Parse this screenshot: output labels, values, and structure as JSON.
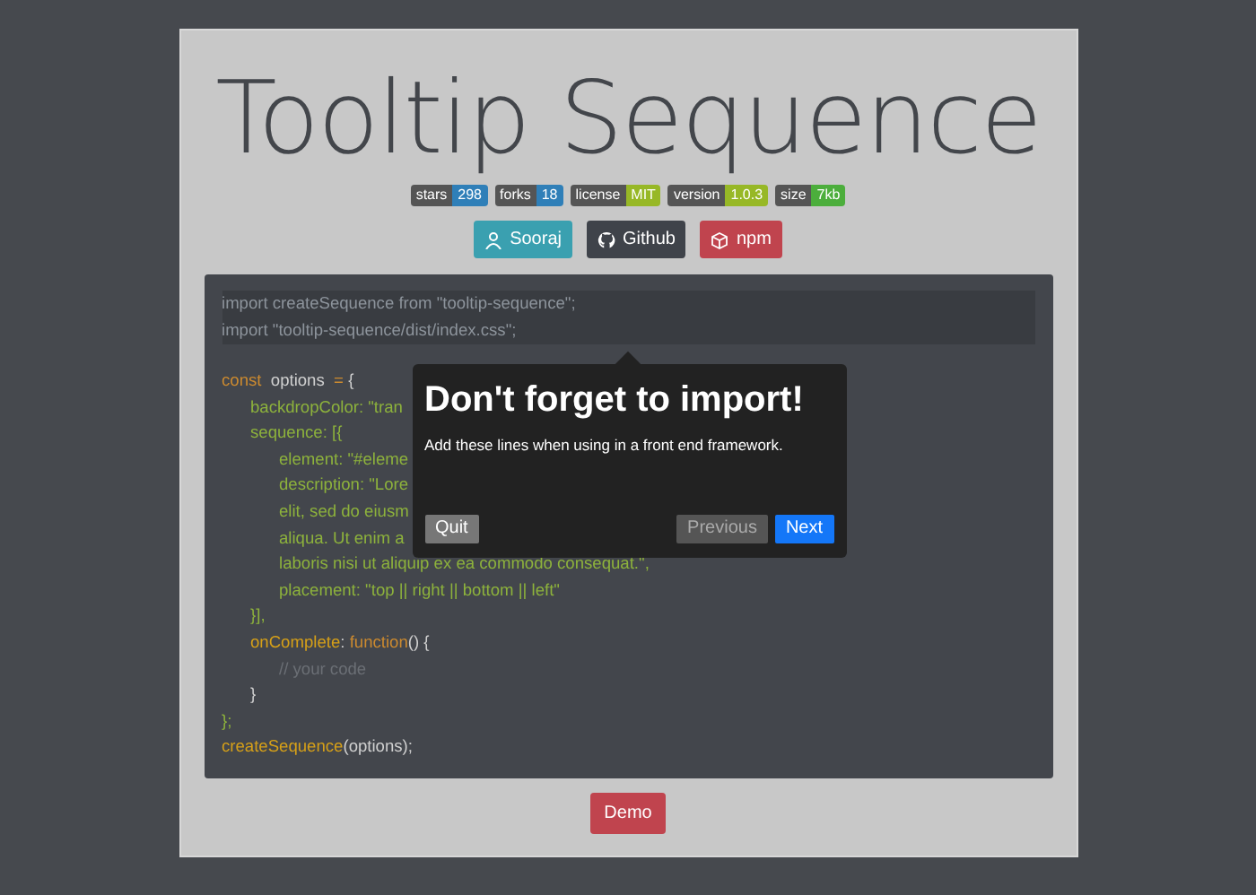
{
  "title": "Tooltip Sequence",
  "badges": [
    {
      "label": "stars",
      "value": "298",
      "color": "#2f7fb8"
    },
    {
      "label": "forks",
      "value": "18",
      "color": "#2f7fb8"
    },
    {
      "label": "license",
      "value": "MIT",
      "color": "#97b826"
    },
    {
      "label": "version",
      "value": "1.0.3",
      "color": "#97b826"
    },
    {
      "label": "size",
      "value": "7kb",
      "color": "#4cae3c"
    }
  ],
  "links": [
    {
      "kind": "person",
      "label": "Sooraj"
    },
    {
      "kind": "github",
      "label": "Github"
    },
    {
      "kind": "npm",
      "label": "npm"
    }
  ],
  "code": {
    "highlighted": [
      "import createSequence from \"tooltip-sequence\";",
      "import \"tooltip-sequence/dist/index.css\";"
    ],
    "lines": [
      {
        "parts": [
          {
            "kind": "keyword",
            "text": "const "
          },
          {
            "kind": "name",
            "text": " options "
          },
          {
            "kind": "keyword",
            "text": " = "
          },
          {
            "kind": "name",
            "text": "{"
          }
        ],
        "children": [
          {
            "parts": [
              {
                "kind": "prop",
                "text": "backdropColor: \"tran"
              }
            ]
          },
          {
            "parts": [
              {
                "kind": "prop",
                "text": "sequence: [{"
              }
            ],
            "children": [
              {
                "parts": [
                  {
                    "kind": "prop",
                    "text": "element: \"#eleme"
                  }
                ]
              },
              {
                "parts": [
                  {
                    "kind": "prop",
                    "text": "description: \"Lore"
                  }
                ]
              },
              {
                "parts": [
                  {
                    "kind": "prop",
                    "text": "elit, sed do eiusm"
                  }
                ]
              },
              {
                "parts": [
                  {
                    "kind": "prop",
                    "text": "aliqua. Ut enim a"
                  }
                ]
              },
              {
                "parts": [
                  {
                    "kind": "prop",
                    "text": "laboris nisi ut aliquip ex ea commodo consequat.\","
                  }
                ]
              },
              {
                "parts": [
                  {
                    "kind": "prop",
                    "text": "placement: \"top || right || bottom || left\""
                  }
                ]
              }
            ]
          },
          {
            "parts": [
              {
                "kind": "prop",
                "text": "}],"
              }
            ]
          },
          {
            "parts": [
              {
                "kind": "func",
                "text": "onComplete"
              },
              {
                "kind": "name",
                "text": ": "
              },
              {
                "kind": "keyword",
                "text": "function"
              },
              {
                "kind": "name",
                "text": "() {"
              }
            ],
            "children": [
              {
                "parts": [
                  {
                    "kind": "comment",
                    "text": "// your code"
                  }
                ]
              }
            ]
          },
          {
            "parts": [
              {
                "kind": "name",
                "text": "}"
              }
            ]
          }
        ]
      },
      {
        "parts": [
          {
            "kind": "prop",
            "text": "};"
          }
        ]
      },
      {
        "parts": [
          {
            "kind": "func",
            "text": "createSequence"
          },
          {
            "kind": "name",
            "text": "(options);"
          }
        ]
      }
    ]
  },
  "tooltip": {
    "title": "Don't forget to import!",
    "description": "Add these lines when using in a front end framework.",
    "buttons": [
      {
        "kind": "quit",
        "label": "Quit"
      },
      {
        "kind": "previous",
        "label": "Previous"
      },
      {
        "kind": "next",
        "label": "Next"
      }
    ]
  },
  "demo_button": "Demo"
}
